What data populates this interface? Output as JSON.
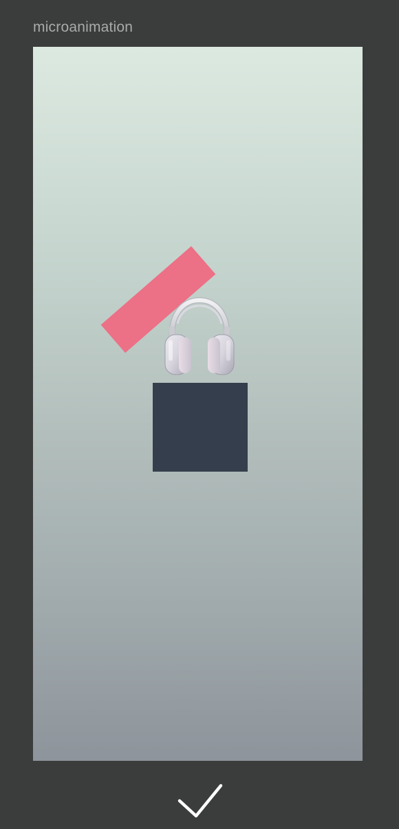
{
  "header": {
    "title": "microanimation"
  },
  "scene": {
    "background_top": "#dce9e1",
    "background_bottom": "#8d949b",
    "pink_shape_color": "#ec7086",
    "dark_square_color": "#343e4c",
    "image_subject": "headphones"
  },
  "actions": {
    "confirm_icon": "checkmark-icon"
  }
}
